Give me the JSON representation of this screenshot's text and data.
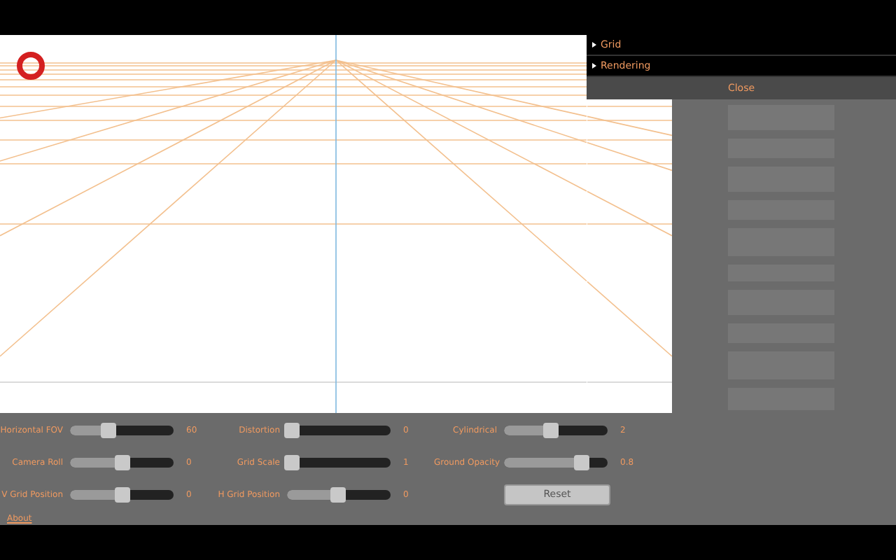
{
  "menu": {
    "items": [
      {
        "label": "Grid"
      },
      {
        "label": "Rendering"
      }
    ],
    "close": "Close"
  },
  "sliders": [
    {
      "label": "Horizontal FOV",
      "level": 0.37,
      "reading": "60"
    },
    {
      "label": "Camera Roll",
      "level": 0.52,
      "reading": "0"
    },
    {
      "label": "V Grid Position",
      "level": 0.52,
      "reading": "0"
    },
    {
      "label": "Distortion",
      "level": 0,
      "reading": "0"
    },
    {
      "label": "Grid Scale",
      "level": 0,
      "reading": "1"
    },
    {
      "label": "H Grid Position",
      "level": 0.5,
      "reading": "0"
    },
    {
      "label": "Cylindrical",
      "level": 0.46,
      "reading": "2"
    },
    {
      "label": "Ground Opacity",
      "level": 0.8,
      "reading": "0.8"
    }
  ],
  "reset_button": "Reset",
  "about_link": "About"
}
